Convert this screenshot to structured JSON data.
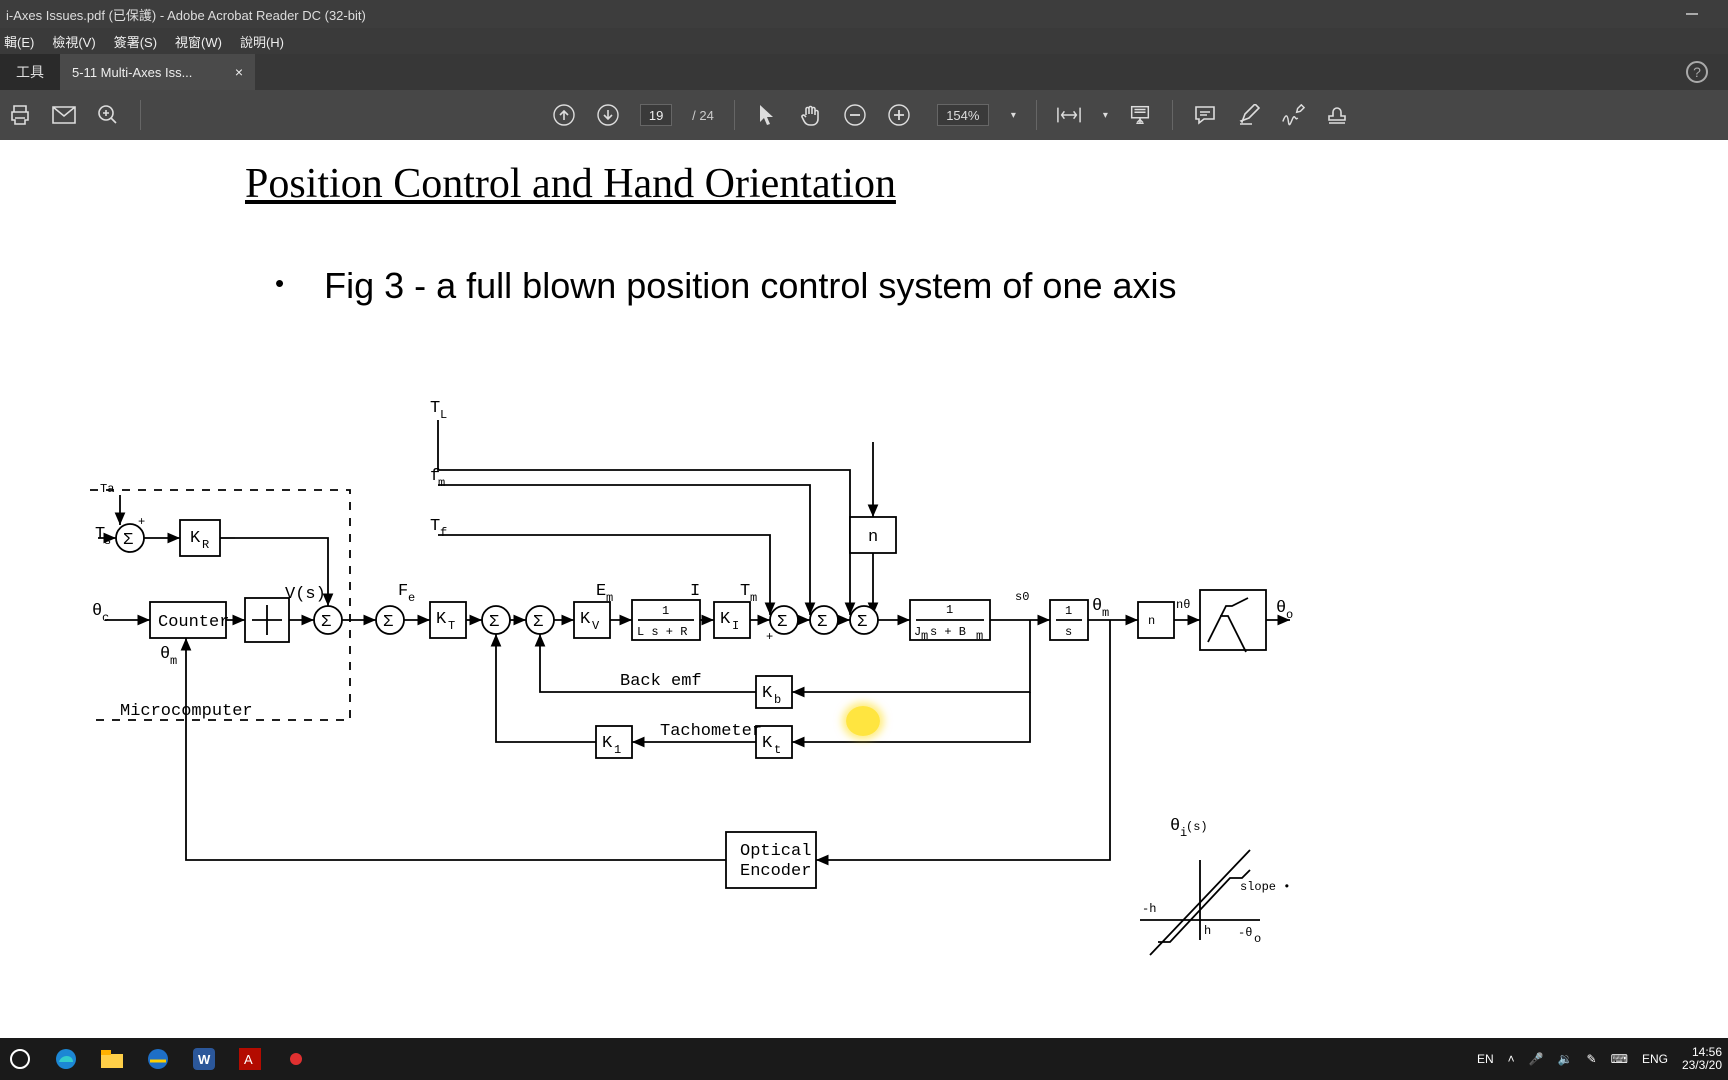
{
  "window": {
    "title": "i-Axes Issues.pdf (已保護) - Adobe Acrobat Reader DC (32-bit)"
  },
  "menu": {
    "edit": "輯(E)",
    "view": "檢視(V)",
    "sign": "簽署(S)",
    "window": "視窗(W)",
    "help": "說明(H)"
  },
  "tabs": {
    "home": "工具",
    "active": "5-11 Multi-Axes Iss...",
    "close": "×"
  },
  "toolbar": {
    "page_current": "19",
    "page_sep": "/",
    "page_total": "24",
    "zoom": "154%"
  },
  "doc": {
    "heading": "Position Control and Hand Orientation",
    "bullet": "Fig 3 - a full blown position control system of one axis"
  },
  "diagram": {
    "labels": {
      "tl": "T",
      "tl_sub": "L",
      "fm": "f",
      "fm_sub": "m",
      "tf": "T",
      "tf_sub": "f",
      "ta": "Ta",
      "kr": "K",
      "kr_sub": "R",
      "theta_c": "θ",
      "theta_c_sub": "c",
      "counter": "Counter",
      "visi": "V(s)",
      "fe": "F",
      "fe_sub": "e",
      "kt": "K",
      "kt_sub": "T",
      "kv": "K",
      "kv_sub": "V",
      "em": "E",
      "em_sub": "m",
      "lsr1": "1",
      "lsr2": "L s + R",
      "i": "I",
      "tm": "T",
      "tm_sub": "m",
      "ki": "K",
      "ki_sub": "I",
      "n": "n",
      "jsb1": "1",
      "jsb2": "J",
      "jsb2m": "m",
      "jsb2s": " s + B",
      "jsb2bm": "m",
      "s0": "s0",
      "s1": "1",
      "s2": "s",
      "theta": "θ",
      "thetam": "m",
      "nth": "nθ",
      "theta0": "θ",
      "theta0s": "o",
      "backemf": "Back emf",
      "kb": "K",
      "kb_sub": "b",
      "tach": "Tachometer",
      "k1": "K",
      "k1_sub": "1",
      "kt2": "K",
      "kt2_sub": "t",
      "opt1": "Optical",
      "opt2": "Encoder",
      "theta_m": "θ",
      "theta_m_sub": "m",
      "micro": "Microcomputer",
      "slope": "slope",
      "theta_isi": "θ",
      "theta_isi_sub": "(s)",
      "theta_isi_i": "i",
      "minus_h": "-h",
      "h": "h",
      "theta0r": "-θ",
      "theta0r_sub": "o"
    }
  },
  "systray": {
    "ime": "EN",
    "lang": "ENG",
    "time": "14:56",
    "date": "23/3/20"
  }
}
